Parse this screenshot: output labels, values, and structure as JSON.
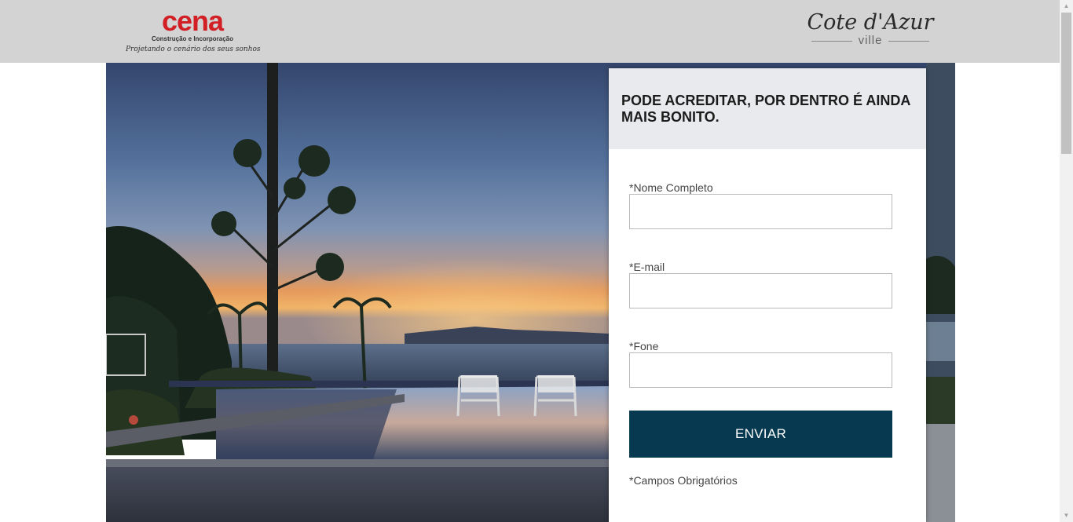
{
  "header": {
    "brand_left": {
      "name": "cena",
      "subtitle": "Construção e Incorporação",
      "tagline": "Projetando o cenário dos seus sonhos"
    },
    "brand_right": {
      "name": "Cote d'Azur",
      "sub": "ville"
    }
  },
  "hero": {
    "image": "sunset-infinity-pool-photo"
  },
  "form": {
    "title": "PODE ACREDITAR, POR DENTRO É AINDA MAIS BONITO.",
    "fields": [
      {
        "label": "*Nome Completo",
        "value": "",
        "placeholder": ""
      },
      {
        "label": "*E-mail",
        "value": "",
        "placeholder": ""
      },
      {
        "label": "*Fone",
        "value": "",
        "placeholder": ""
      }
    ],
    "submit_label": "ENVIAR",
    "required_note": "*Campos Obrigatórios"
  },
  "colors": {
    "header_bg": "#d3d3d3",
    "brand_red": "#d21f26",
    "button_bg": "#073a50",
    "form_head_bg": "#e9eaee"
  },
  "icons": {
    "scroll_up": "chevron-up-icon",
    "scroll_down": "chevron-down-icon"
  }
}
